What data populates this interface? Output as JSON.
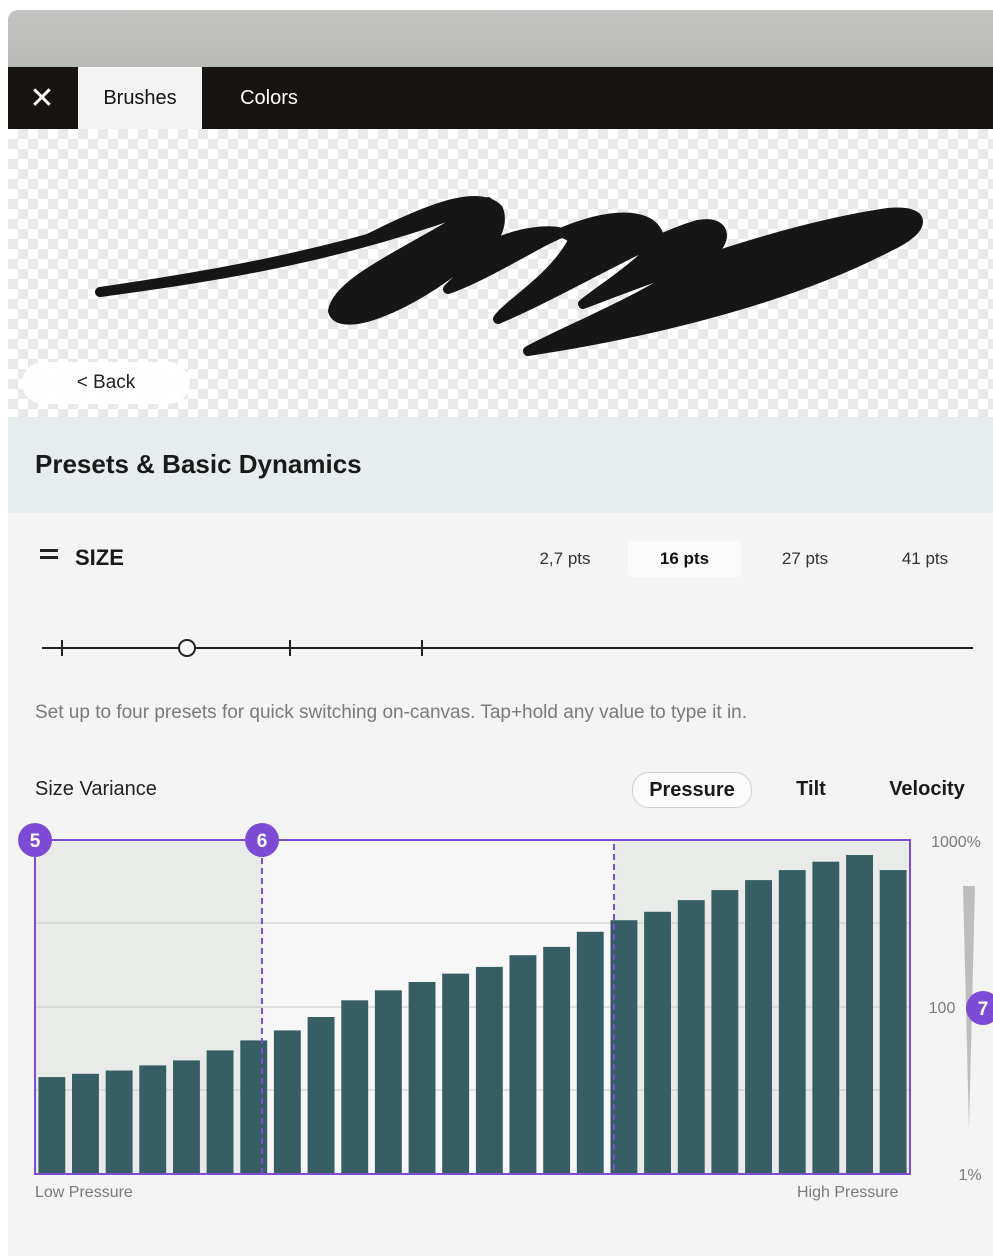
{
  "tabs": {
    "close": "✕",
    "brushes": "Brushes",
    "colors": "Colors"
  },
  "preview": {
    "back": "< Back"
  },
  "section": {
    "title": "Presets & Basic Dynamics"
  },
  "size": {
    "label": "SIZE",
    "presets": [
      "2,7 pts",
      "16 pts",
      "27 pts",
      "41 pts"
    ],
    "active_preset": "16 pts"
  },
  "help_text": "Set up to four presets for quick switching on-canvas. Tap+hold any value to type it in.",
  "variance": {
    "label": "Size Variance",
    "modes": [
      "Pressure",
      "Tilt",
      "Velocity"
    ],
    "active_mode": "Pressure"
  },
  "markers": {
    "m5": "5",
    "m6": "6",
    "m7": "7"
  },
  "colors": {
    "bar": "#365e63",
    "accent": "#7d4bd6",
    "tabbar": "#161310"
  },
  "chart_data": {
    "type": "bar",
    "title": "",
    "xlabel_low": "Low Pressure",
    "xlabel_high": "High Pressure",
    "y_tick_labels": [
      "1000%",
      "100",
      "1%"
    ],
    "ylim": [
      0,
      1000
    ],
    "values": [
      29,
      30,
      31,
      32.5,
      34,
      37,
      40,
      43,
      47,
      52,
      55,
      57.5,
      60,
      62,
      65.5,
      68,
      72.5,
      76,
      78.5,
      82,
      85,
      88,
      91,
      93.5,
      95.5,
      91
    ]
  }
}
